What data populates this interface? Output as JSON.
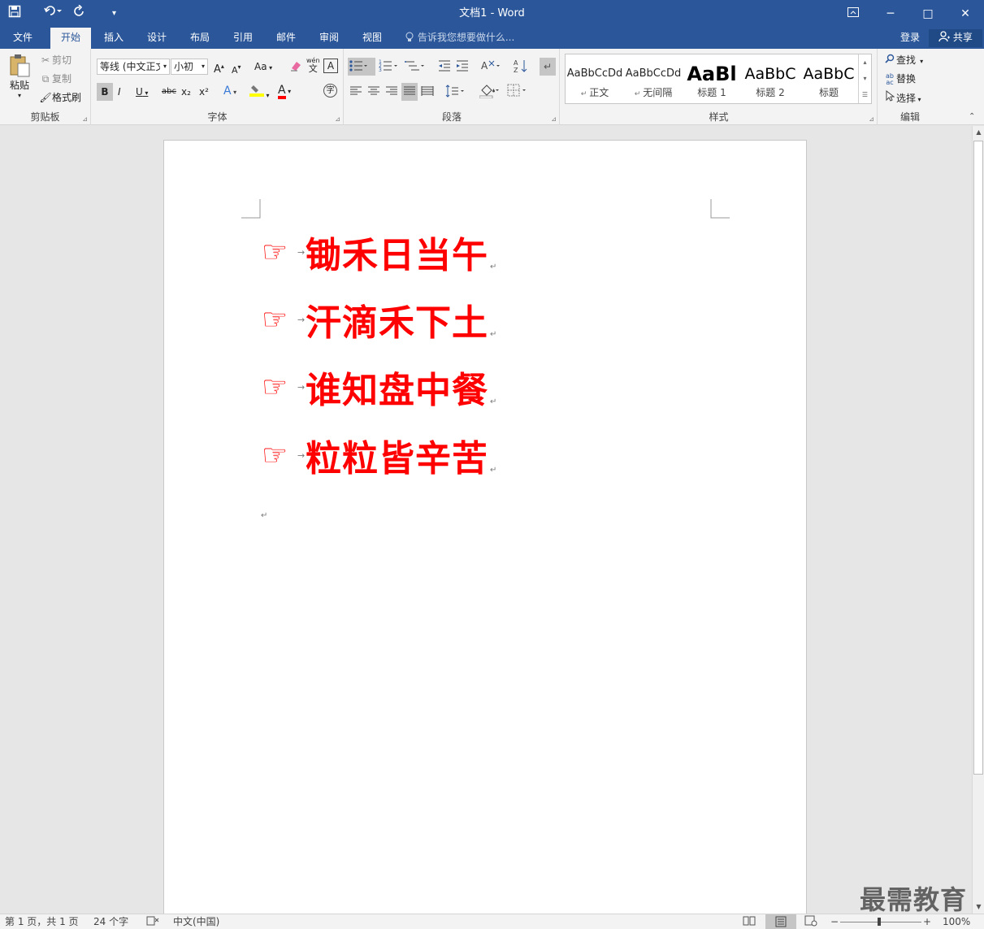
{
  "titlebar": {
    "title": "文档1 - Word",
    "save_icon": "save-icon",
    "undo_icon": "undo-icon",
    "redo_icon": "redo-icon",
    "customize_icon": "customize-qat-icon",
    "ribbon_display_icon": "ribbon-display-options-icon",
    "minimize": "─",
    "maximize": "□",
    "close": "✕"
  },
  "tabs": [
    {
      "label": "文件"
    },
    {
      "label": "开始",
      "active": true
    },
    {
      "label": "插入"
    },
    {
      "label": "设计"
    },
    {
      "label": "布局"
    },
    {
      "label": "引用"
    },
    {
      "label": "邮件"
    },
    {
      "label": "审阅"
    },
    {
      "label": "视图"
    }
  ],
  "tell_me": "告诉我您想要做什么...",
  "login": "登录",
  "share": "共享",
  "clipboard": {
    "label": "剪贴板",
    "paste": "粘贴",
    "cut": "剪切",
    "copy": "复制",
    "format_painter": "格式刷"
  },
  "font": {
    "label": "字体",
    "family": "等线 (中文正文",
    "size": "小初",
    "grow": "A",
    "shrink": "A",
    "change_case": "Aa",
    "bold": "B",
    "italic": "I",
    "underline": "U",
    "strike": "abc",
    "subscript": "x₂",
    "superscript": "x²",
    "text_effects": "A",
    "font_color": "A",
    "char_border": "A",
    "phonetic": "wén",
    "phonetic_sub": "文",
    "enclose": "字"
  },
  "paragraph": {
    "label": "段落"
  },
  "styles": {
    "label": "样式",
    "items": [
      {
        "preview": "AaBbCcDd",
        "name": "正文"
      },
      {
        "preview": "AaBbCcDd",
        "name": "无间隔"
      },
      {
        "preview": "AaBl",
        "name": "标题 1"
      },
      {
        "preview": "AaBbC",
        "name": "标题 2"
      },
      {
        "preview": "AaBbC",
        "name": "标题"
      }
    ]
  },
  "editing": {
    "label": "编辑",
    "find": "查找",
    "replace": "替换",
    "select": "选择"
  },
  "document": {
    "lines": [
      {
        "bullet": "☞",
        "text": "锄禾日当午"
      },
      {
        "bullet": "☞",
        "text": "汗滴禾下土"
      },
      {
        "bullet": "☞",
        "text": "谁知盘中餐"
      },
      {
        "bullet": "☞",
        "text": "粒粒皆辛苦"
      }
    ],
    "tab_mark": "→",
    "para_mark": "↵",
    "text_color": "#ff0000"
  },
  "status": {
    "page": "第 1 页，共 1 页",
    "words": "24 个字",
    "lang": "中文(中国)",
    "zoom": "100%"
  },
  "watermark": "最需教育",
  "colors": {
    "brand": "#2b579a",
    "ribbon": "#f3f3f3"
  }
}
